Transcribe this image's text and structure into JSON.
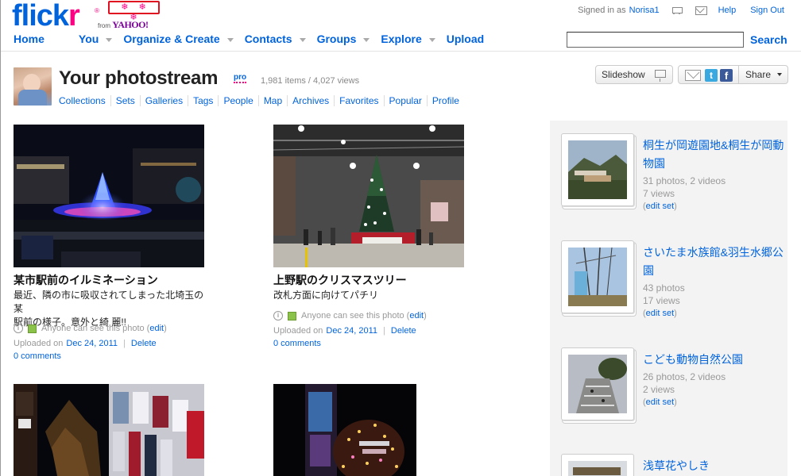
{
  "header": {
    "logo": "flickr",
    "logo_reg": "®",
    "from_label": "from",
    "yahoo": "YAHOO!",
    "holiday_badge": "❄ ❄ ❄",
    "signed_in_label": "Signed in as",
    "username": "Norisa1",
    "help": "Help",
    "sign_out": "Sign Out",
    "search_button": "Search",
    "search_placeholder": ""
  },
  "nav": [
    {
      "label": "Home",
      "dropdown": false
    },
    {
      "label": "You",
      "dropdown": true
    },
    {
      "label": "Organize & Create",
      "dropdown": true
    },
    {
      "label": "Contacts",
      "dropdown": true
    },
    {
      "label": "Groups",
      "dropdown": true
    },
    {
      "label": "Explore",
      "dropdown": true
    },
    {
      "label": "Upload",
      "dropdown": false
    }
  ],
  "photostream": {
    "title": "Your photostream",
    "pro": "pro",
    "counts": "1,981 items / 4,027 views",
    "subnav": [
      "Collections",
      "Sets",
      "Galleries",
      "Tags",
      "People",
      "Map",
      "Archives",
      "Favorites",
      "Popular",
      "Profile"
    ],
    "slideshow": "Slideshow",
    "share": "Share",
    "tw_glyph": "t",
    "fb_glyph": "f",
    "info_glyph": "i"
  },
  "photos": [
    {
      "title": "某市駅前のイルミネーション",
      "desc_lines": [
        "最近、隣の市に吸収されてしまった北埼玉の某",
        "駅前の様子。意外と綺 麗!!"
      ],
      "privacy": "Anyone can see this photo",
      "edit": "edit",
      "uploaded_label": "Uploaded on",
      "date": "Dec 24, 2011",
      "delete": "Delete",
      "comments": "0 comments"
    },
    {
      "title": "上野駅のクリスマスツリー",
      "desc_lines": [
        "改札方面に向けてパチリ"
      ],
      "privacy": "Anyone can see this photo",
      "edit": "edit",
      "uploaded_label": "Uploaded on",
      "date": "Dec 24, 2011",
      "delete": "Delete",
      "comments": "0 comments"
    }
  ],
  "sets": [
    {
      "title": "桐生が岡遊園地&桐生が岡動物園",
      "line1": "31 photos, 2 videos",
      "line2": "7 views",
      "edit": "edit set"
    },
    {
      "title": "さいたま水族館&羽生水郷公園",
      "line1": "43 photos",
      "line2": "17 views",
      "edit": "edit set"
    },
    {
      "title": "こども動物自然公園",
      "line1": "26 photos, 2 videos",
      "line2": "2 views",
      "edit": "edit set"
    },
    {
      "title": "浅草花やしき",
      "line1": "",
      "line2": "",
      "edit": ""
    }
  ],
  "punct": {
    "open": "(",
    "close": ")",
    "bar": "|"
  }
}
